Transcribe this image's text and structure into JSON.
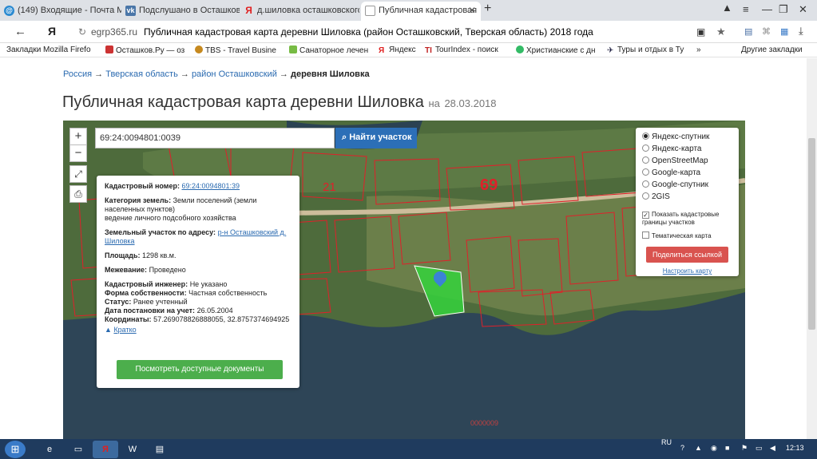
{
  "browser": {
    "tabs": [
      {
        "label": "(149) Входящие - Почта Ма",
        "icon": "mail-icon"
      },
      {
        "label": "Подслушано в Осташкове",
        "icon": "vk-icon"
      },
      {
        "label": "д.шиловка осташковского р",
        "icon": "yandex-icon"
      },
      {
        "label": "Публичная кадастровая",
        "icon": "page-icon"
      }
    ],
    "new_tab": "+",
    "url_host": "egrp365.ru",
    "url_title": "Публичная кадастровая карта деревни Шиловка (район Осташковский, Тверская область) 2018 года",
    "bookmarks": [
      "Закладки Mozilla Firefo",
      "Осташков.Ру — оз",
      "TBS - Travel Busine",
      "Санаторное лечен",
      "Яндекс",
      "TourIndex - поиск",
      "Христианские с дн",
      "Туры и отдых в Ту"
    ],
    "bookmarks_more": "»",
    "other_bookmarks": "Другие закладки"
  },
  "breadcrumb": {
    "items": [
      "Россия",
      "Тверская область",
      "район Осташковский"
    ],
    "separator": "→",
    "current": "деревня Шиловка"
  },
  "heading": {
    "title": "Публичная кадастровая карта деревни Шиловка",
    "date_prefix": "на",
    "date": "28.03.2018"
  },
  "map": {
    "zoom_in": "+",
    "zoom_out": "−",
    "search_value": "69:24:0094801:0039",
    "search_button": "Найти участок",
    "district_labels": [
      "69",
      "21"
    ],
    "bottom_label": "0000009",
    "info": {
      "cad_number_label": "Кадастровый номер:",
      "cad_number": "69:24:0094801:39",
      "category_label": "Категория земель:",
      "category_value": "Земли поселений (земли населенных пунктов)",
      "use_value": "ведение личного подсобного хозяйства",
      "address_label": "Земельный участок по адресу:",
      "address_value": "р-н Осташковский д. Шиловка",
      "area_label": "Площадь:",
      "area_value": "1298 кв.м.",
      "survey_label": "Межевание:",
      "survey_value": "Проведено",
      "engineer_label": "Кадастровый инженер:",
      "engineer_value": "Не указано",
      "ownership_label": "Форма собственности:",
      "ownership_value": "Частная собственность",
      "status_label": "Статус:",
      "status_value": "Ранее учтенный",
      "date_label": "Дата постановки на учет:",
      "date_value": "26.05.2004",
      "coords_label": "Координаты:",
      "coords_value": "57.269078826888055, 32.8757374694925",
      "collapse_link": "Кратко",
      "docs_button": "Посмотреть доступные документы"
    },
    "layers": {
      "options": [
        "Яндекс-спутник",
        "Яндекс-карта",
        "OpenStreetMap",
        "Google-карта",
        "Google-спутник",
        "2GIS"
      ],
      "selected": "Яндекс-спутник",
      "show_borders": "Показать кадастровые границы участков",
      "thematic": "Тематическая карта",
      "share_button": "Поделиться ссылкой",
      "setup_link": "Настроить карту"
    }
  },
  "taskbar": {
    "lang": "RU",
    "time": "12:13"
  },
  "colors": {
    "link": "#2a6ab0",
    "search_button": "#2c6fb7",
    "docs_button": "#4cae4c",
    "share_button": "#d9534f",
    "parcel_border": "#e0202a",
    "selected_parcel": "#35d23c",
    "water": "#2e4557"
  }
}
